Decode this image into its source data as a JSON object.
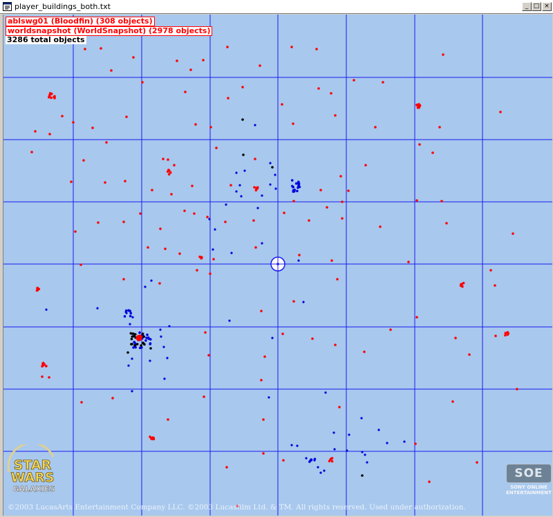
{
  "window": {
    "title": "player_buildings_both.txt",
    "controls": {
      "minimize": "_",
      "maximize": "□",
      "close": "×"
    }
  },
  "legend": [
    {
      "text": "ablswg01 (Bloodfin) (308 objects)",
      "color": "#ff0000"
    },
    {
      "text": "worldsnapshot (WorldSnapshot) (2978 objects)",
      "color": "#ff0000"
    },
    {
      "text": "3286 total objects",
      "color": "#000000"
    }
  ],
  "colors": {
    "map_background": "#a8c8ee",
    "grid_lines": "#1a1aee",
    "bloodfin_points": "#0000dd",
    "snapshot_points": "#ff0000",
    "overlap_points": "#000000"
  },
  "logos": {
    "star_wars": {
      "line1": "STAR",
      "line2": "WARS",
      "line3": "GALAXIES"
    },
    "soe": {
      "badge": "SOE",
      "line1": "SONY ONLINE",
      "line2": "ENTERTAINMENT"
    }
  },
  "copyright": "©2003 LucasArts Entertainment Company LLC. ©2003 Lucasfilm Ltd. & TM. All rights reserved. Used under authorization.",
  "icons": {
    "app": "document-icon",
    "center": "crosshair-icon"
  }
}
